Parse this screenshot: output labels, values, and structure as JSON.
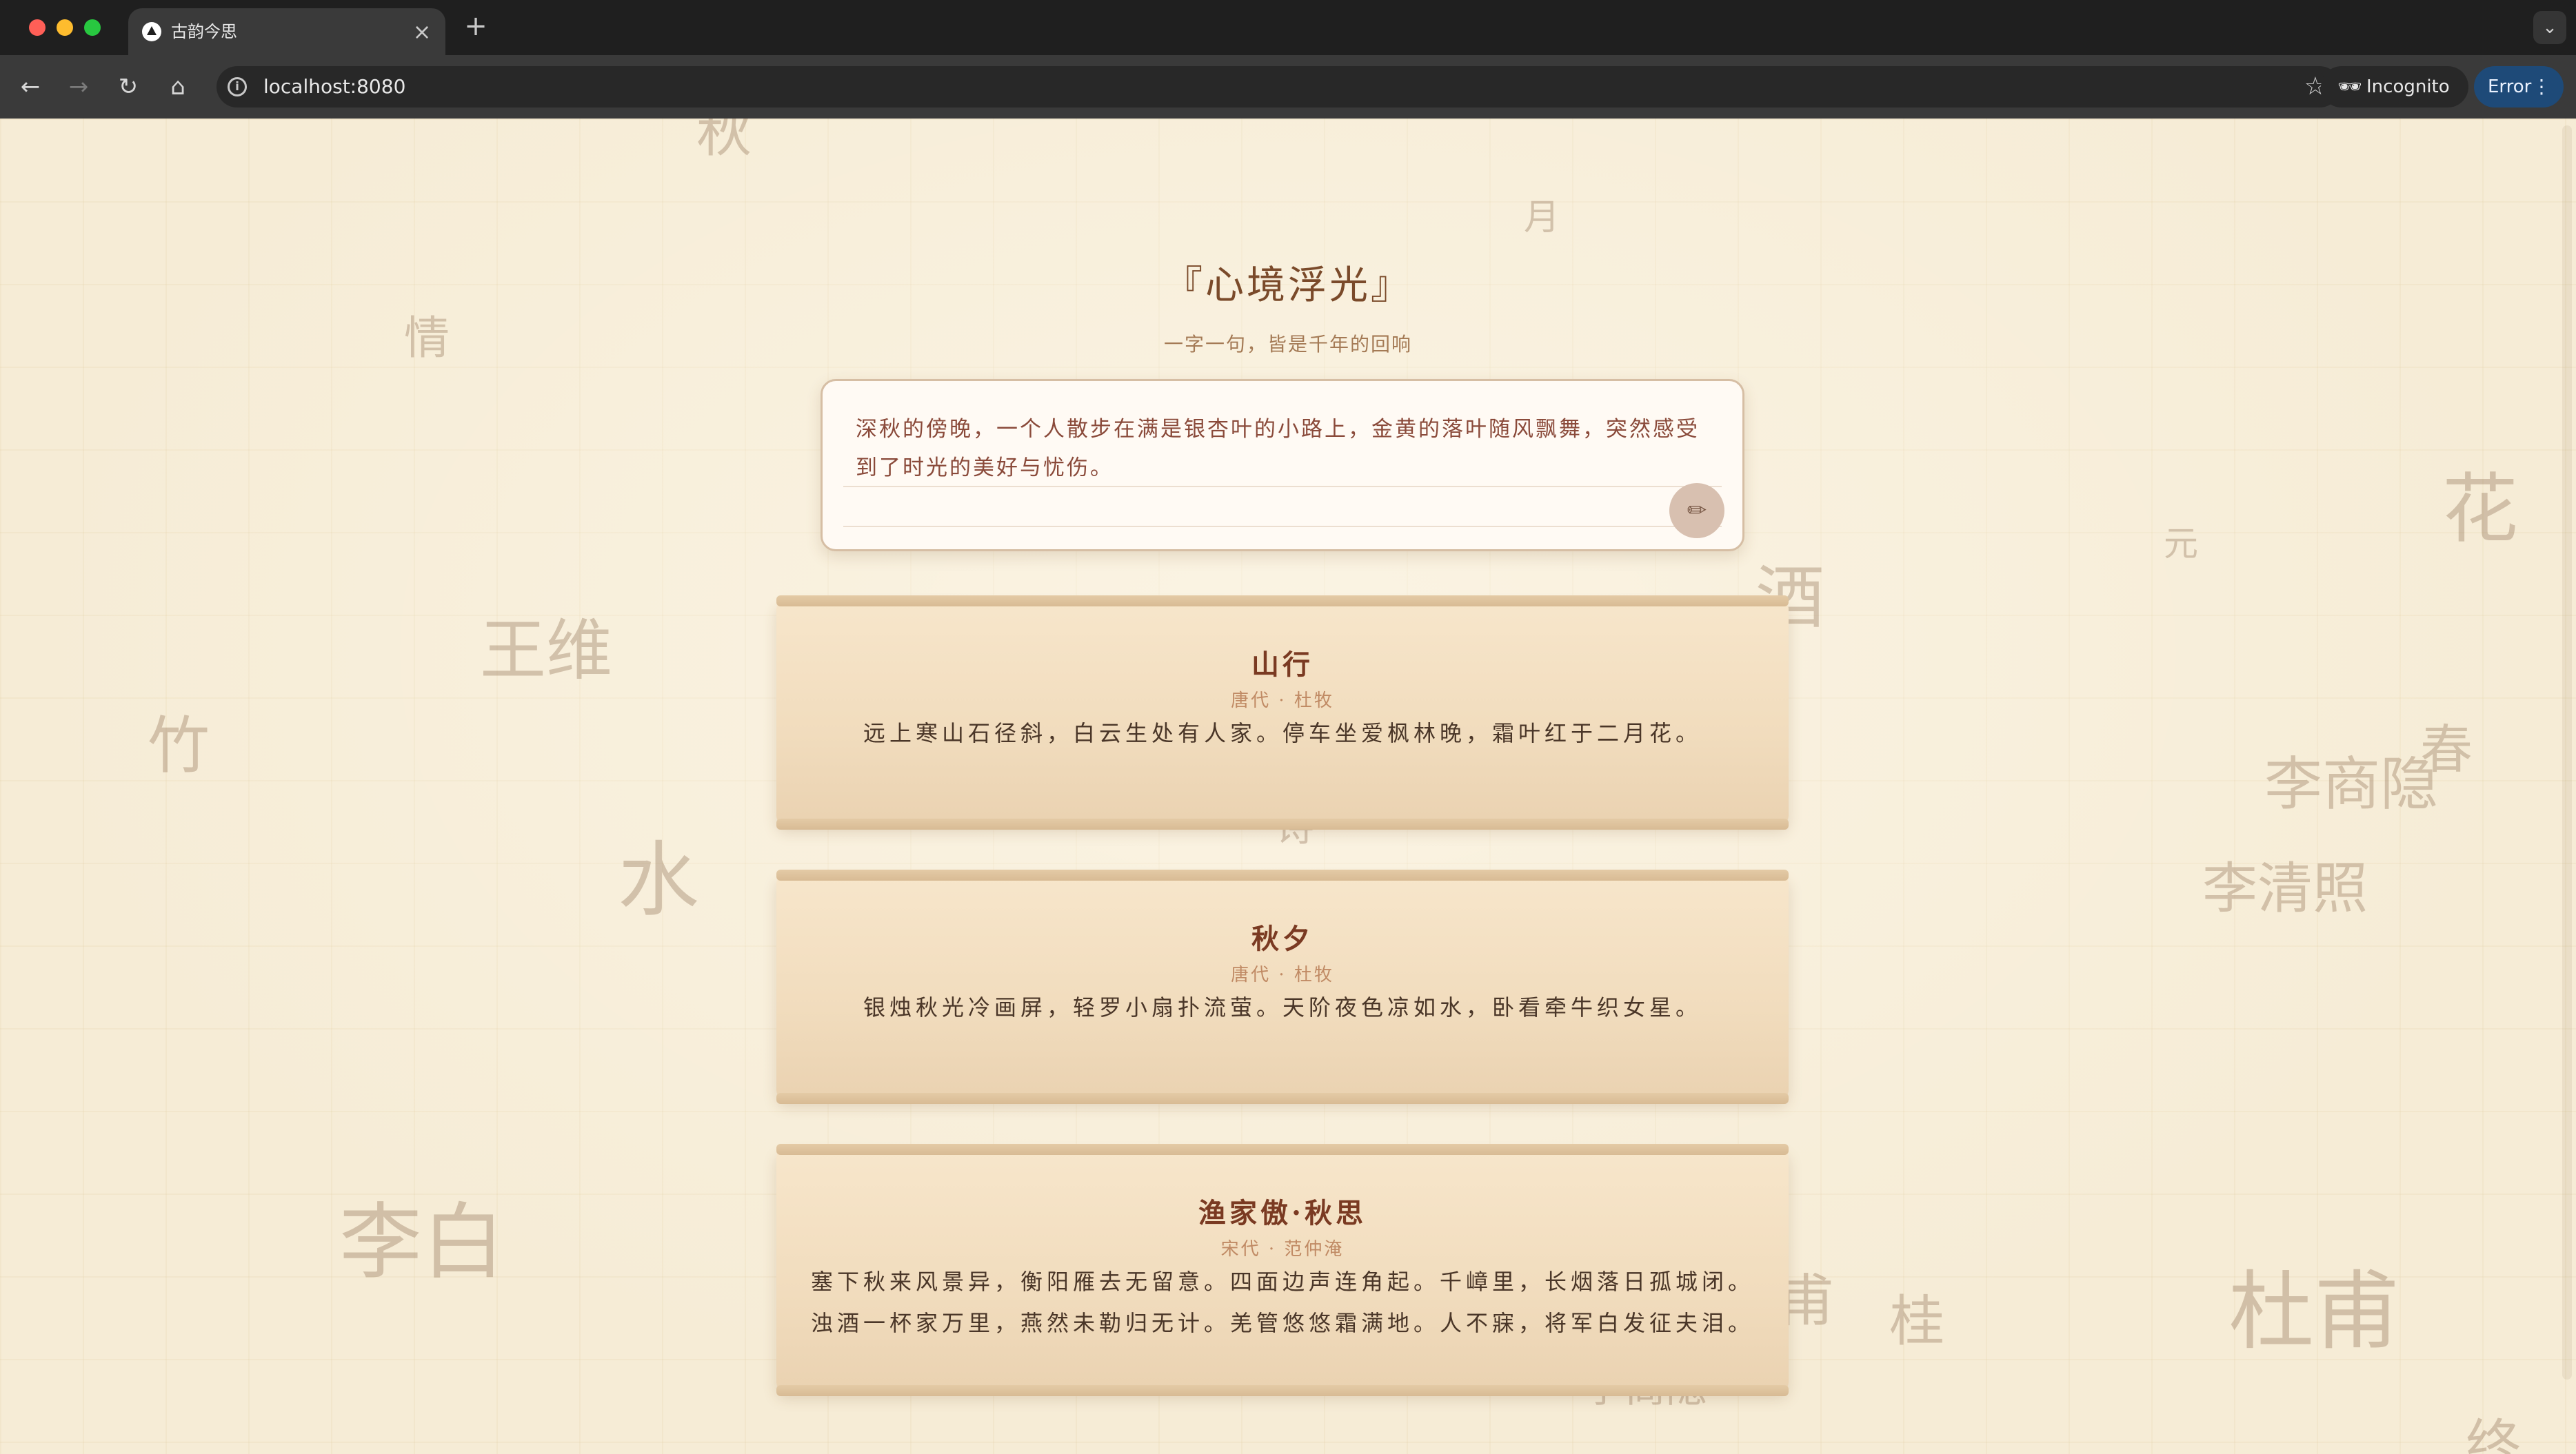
{
  "browser": {
    "tab_title": "古韵今思",
    "tab_close": "×",
    "new_tab": "+",
    "tab_menu": "⌄",
    "back": "←",
    "forward": "→",
    "reload": "↻",
    "home": "⌂",
    "info": "i",
    "url": "localhost:8080",
    "star": "☆",
    "incognito_label": "Incognito",
    "incognito_icon": "🕶",
    "error_label": "Error",
    "menu_dots": "⋮"
  },
  "hero": {
    "title": "『心境浮光』",
    "subtitle": "一字一句，皆是千年的回响"
  },
  "prompt": {
    "text": "深秋的傍晚，一个人散步在满是银杏叶的小路上，金黄的落叶随风飘舞，突然感受到了时光的美好与忧伤。",
    "send_icon": "✏"
  },
  "poems": [
    {
      "title": "山行",
      "meta": "唐代 · 杜牧",
      "lines": [
        "远上寒山石径斜，白云生处有人家。停车坐爱枫林晚，霜叶红于二月花。"
      ]
    },
    {
      "title": "秋夕",
      "meta": "唐代 · 杜牧",
      "lines": [
        "银烛秋光冷画屏，轻罗小扇扑流萤。天阶夜色凉如水，卧看牵牛织女星。"
      ]
    },
    {
      "title": "渔家傲·秋思",
      "meta": "宋代 · 范仲淹",
      "lines": [
        "塞下秋来风景异，衡阳雁去无留意。四面边声连角起。千嶂里，长烟落日孤城闭。",
        "浊酒一杯家万里，燕然未勒归无计。羌管悠悠霜满地。人不寐，将军白发征夫泪。"
      ]
    }
  ],
  "background_chars": [
    "秋",
    "月",
    "情",
    "花",
    "元",
    "酒",
    "王维",
    "竹",
    "春",
    "李商隐",
    "水",
    "诗",
    "李清照",
    "李白",
    "甫",
    "桂",
    "杜甫",
    "李商隐",
    "终"
  ],
  "colors": {
    "page_bg": "#f6ecd6",
    "accent": "#7a3a22",
    "meta": "#c08a64",
    "error_pill": "#1e4a78"
  }
}
